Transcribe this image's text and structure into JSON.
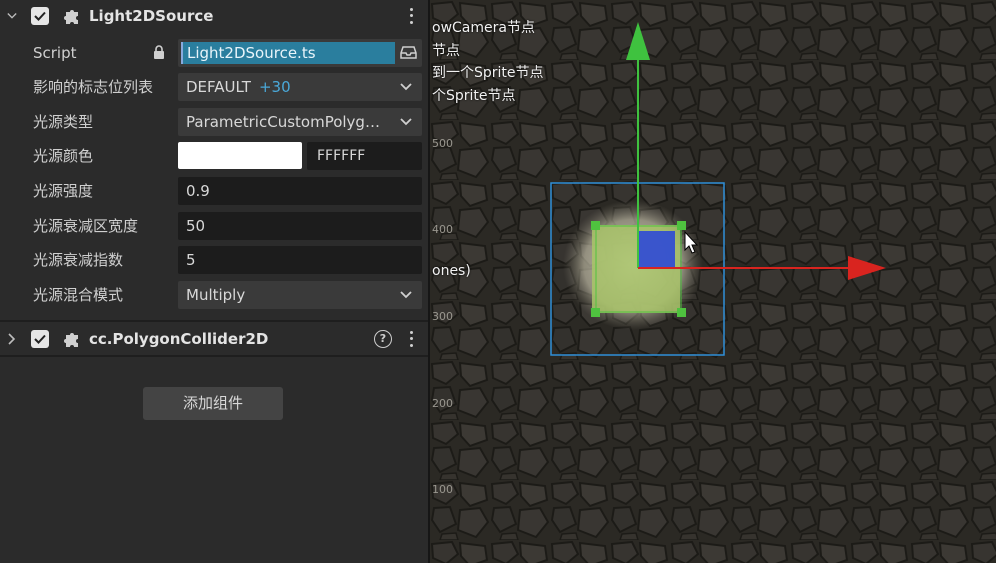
{
  "inspector": {
    "light_component": {
      "title": "Light2DSource",
      "props": {
        "script_label": "Script",
        "script_value": "Light2DSource.ts",
        "flags_label": "影响的标志位列表",
        "flags_value": "DEFAULT",
        "flags_extra": "+30",
        "type_label": "光源类型",
        "type_value": "ParametricCustomPolyg…",
        "color_label": "光源颜色",
        "color_hex": "FFFFFF",
        "color_value": "#ffffff",
        "intensity_label": "光源强度",
        "intensity_value": "0.9",
        "falloff_width_label": "光源衰减区宽度",
        "falloff_width_value": "50",
        "falloff_exp_label": "光源衰减指数",
        "falloff_exp_value": "5",
        "blend_label": "光源混合模式",
        "blend_value": "Multiply"
      }
    },
    "collider_component": {
      "title": "cc.PolygonCollider2D"
    },
    "add_component_label": "添加组件"
  },
  "scene": {
    "notes": [
      "owCamera节点",
      "节点",
      "到一个Sprite节点",
      "个Sprite节点",
      "ones)"
    ],
    "ruler_ticks": [
      "500",
      "400",
      "300",
      "200",
      "100"
    ],
    "gizmo_colors": {
      "y_axis": "#3fc23f",
      "x_axis": "#d9241f",
      "selection": "#2f8fd8"
    }
  },
  "icons": [
    "chevron-down-icon",
    "chevron-right-icon",
    "checkbox-icon",
    "puzzle-icon",
    "more-icon",
    "lock-icon",
    "inbox-icon",
    "help-icon",
    "cursor-icon"
  ]
}
